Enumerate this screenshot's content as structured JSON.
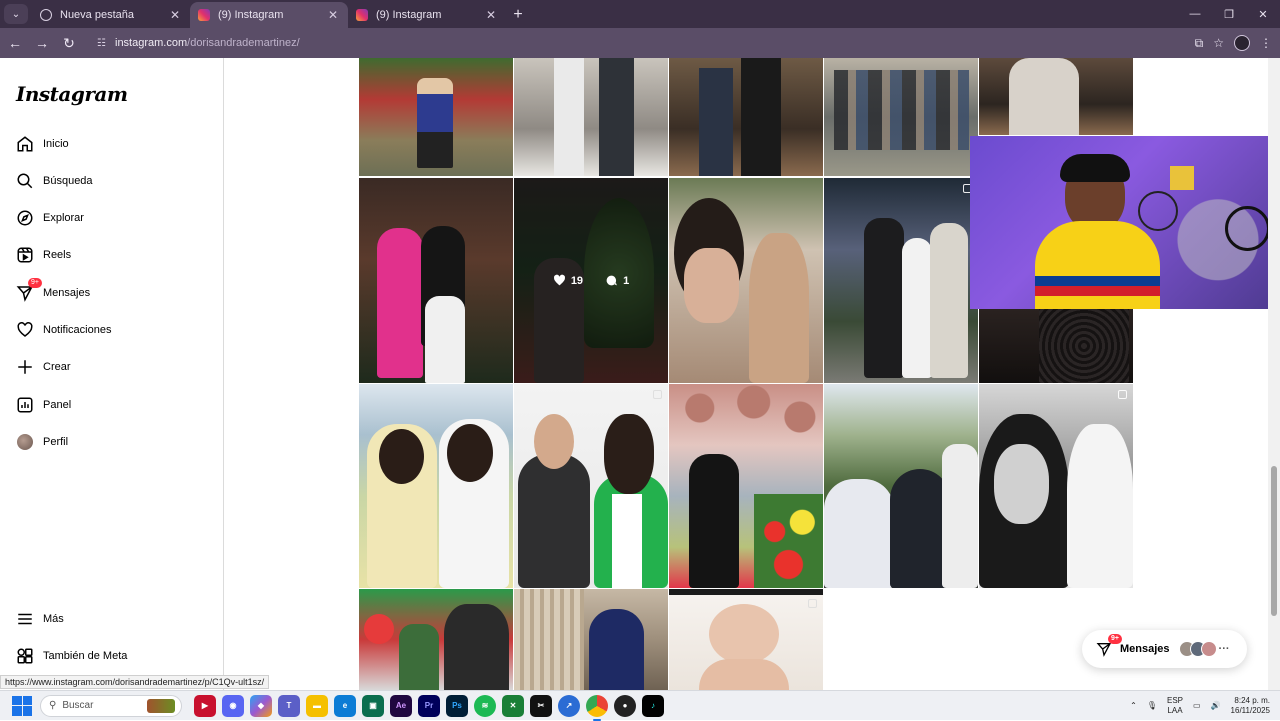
{
  "browser": {
    "tabs": [
      {
        "title": "Nueva pestaña",
        "favicon": "globe-icon",
        "active": false
      },
      {
        "title": "(9) Instagram",
        "favicon": "instagram-icon",
        "active": true
      },
      {
        "title": "(9) Instagram",
        "favicon": "instagram-icon",
        "active": false
      }
    ],
    "url_host": "instagram.com",
    "url_path": "/dorisandrademartinez/",
    "status_url": "https://www.instagram.com/dorisandrademartinez/p/C1Qv-ult1sz/"
  },
  "sidebar": {
    "logo": "Instagram",
    "items": [
      {
        "label": "Inicio",
        "icon": "home-icon"
      },
      {
        "label": "Búsqueda",
        "icon": "search-icon"
      },
      {
        "label": "Explorar",
        "icon": "compass-icon"
      },
      {
        "label": "Reels",
        "icon": "reels-icon"
      },
      {
        "label": "Mensajes",
        "icon": "messenger-icon",
        "badge": "9+"
      },
      {
        "label": "Notificaciones",
        "icon": "heart-icon"
      },
      {
        "label": "Crear",
        "icon": "plus-icon"
      },
      {
        "label": "Panel",
        "icon": "chart-icon"
      },
      {
        "label": "Perfil",
        "icon": "avatar"
      }
    ],
    "bottom_items": [
      {
        "label": "Más",
        "icon": "menu-icon"
      },
      {
        "label": "También de Meta",
        "icon": "meta-apps-icon"
      }
    ]
  },
  "hover_post": {
    "likes": "19",
    "comments": "1"
  },
  "messages_pill": {
    "label": "Mensajes",
    "badge": "9+"
  },
  "taskbar": {
    "search_placeholder": "Buscar",
    "lang_line1": "ESP",
    "lang_line2": "LAA",
    "time": "8:24 p. m.",
    "date": "16/11/2025"
  },
  "colors": {
    "chrome_dark": "#3a2f45",
    "chrome_mid": "#5a4d67",
    "badge_red": "#ff3040"
  }
}
